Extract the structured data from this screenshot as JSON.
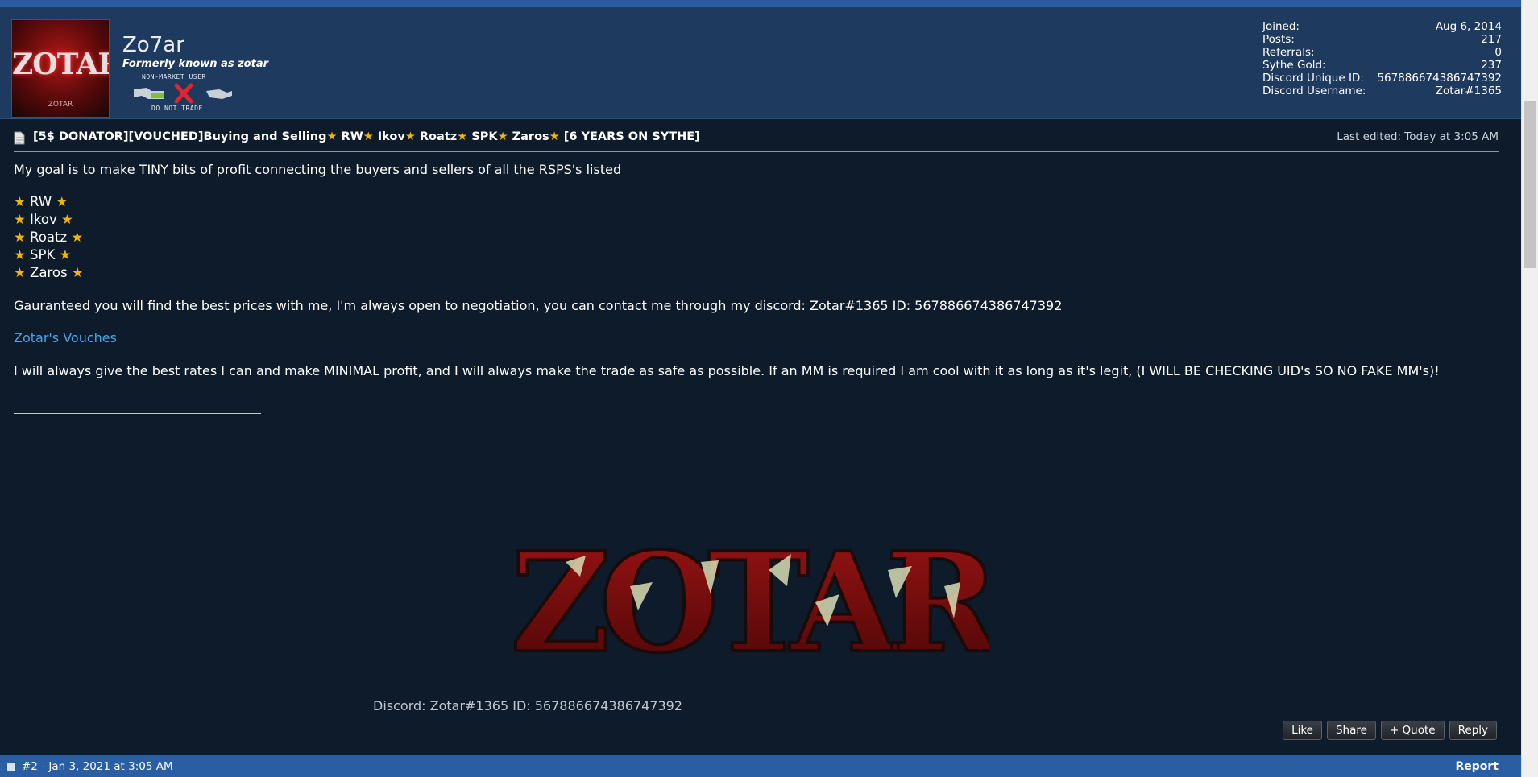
{
  "post": {
    "username": "Zo7ar",
    "formerly": "Formerly known as zotar",
    "avatar_text": "ZOTAR",
    "avatar_subtext": "ZOTAR",
    "badge": {
      "top": "NON-MARKET USER",
      "bottom": "DO NOT TRADE"
    },
    "stats": [
      {
        "label": "Joined:",
        "value": "Aug 6, 2014"
      },
      {
        "label": "Posts:",
        "value": "217"
      },
      {
        "label": "Referrals:",
        "value": "0"
      },
      {
        "label": "Sythe Gold:",
        "value": "237"
      },
      {
        "label": "Discord Unique ID:",
        "value": "567886674386747392"
      },
      {
        "label": "Discord Username:",
        "value": "Zotar#1365"
      }
    ],
    "title_parts": [
      "[5$ DONATOR][VOUCHED]Buying and Selling",
      "RW",
      "Ikov",
      "Roatz",
      "SPK",
      "Zaros",
      "[6 YEARS ON SYTHE]"
    ],
    "star_glyph": "★",
    "last_edited": "Last edited: Today at 3:05 AM",
    "intro": "My goal is to make TINY bits of profit connecting the buyers and sellers of all the RSPS's listed",
    "servers": [
      "RW",
      "Ikov",
      "Roatz",
      "SPK",
      "Zaros"
    ],
    "guarantee": "Gauranteed you will find the best prices with me, I'm always open to negotiation, you can contact me through my discord: Zotar#1365 ID: 567886674386747392",
    "vouches_link": "Zotar's Vouches",
    "promise": "I will always give the best rates I can and make MINIMAL profit, and I will always make the trade as safe as possible. If an MM is required I am cool with it as long as it's legit, (I WILL BE CHECKING UID's SO NO FAKE MM's)!",
    "signature_logo_text": "ZOTAR",
    "signature_discord": "Discord: Zotar#1365 ID: 567886674386747392",
    "actions": {
      "like": "Like",
      "share": "Share",
      "quote": "+ Quote",
      "reply": "Reply"
    }
  },
  "next_post": {
    "meta": "#2 - Jan 3, 2021 at 3:05 AM",
    "report": "Report"
  },
  "colors": {
    "header_bg": "#1f3a5f",
    "post_bg": "#0e1b2a",
    "footer_bg": "#2a5ea3",
    "link": "#4ea3e6",
    "star": "#f3b600"
  }
}
